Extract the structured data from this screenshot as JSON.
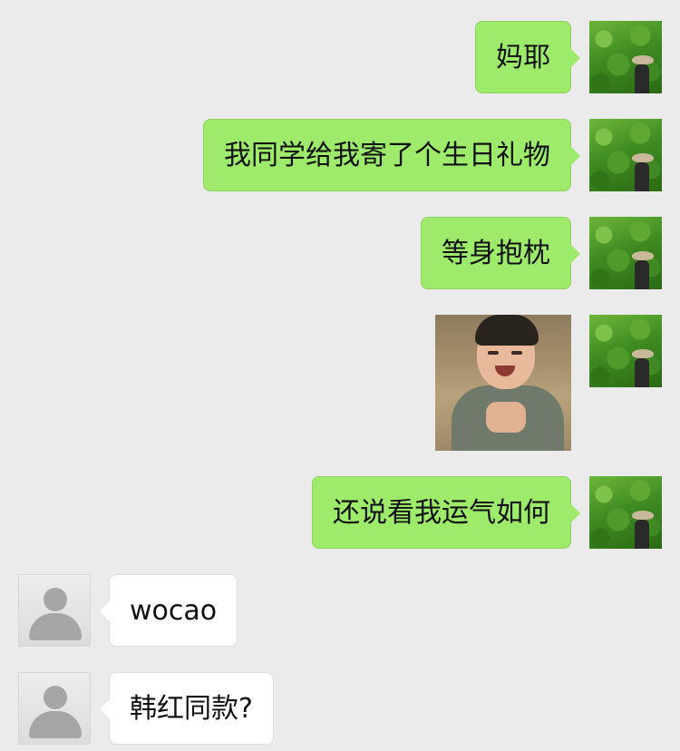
{
  "messages": [
    {
      "sender": "self",
      "type": "text",
      "text": "妈耶"
    },
    {
      "sender": "self",
      "type": "text",
      "text": "我同学给我寄了个生日礼物"
    },
    {
      "sender": "self",
      "type": "text",
      "text": "等身抱枕"
    },
    {
      "sender": "self",
      "type": "sticker",
      "sticker": "crying-child-sticker"
    },
    {
      "sender": "self",
      "type": "text",
      "text": "还说看我运气如何"
    },
    {
      "sender": "other",
      "type": "text",
      "text": "wocao"
    },
    {
      "sender": "other",
      "type": "text",
      "text": "韩红同款?"
    }
  ],
  "colors": {
    "background": "#ebebeb",
    "self_bubble": "#9eea6a",
    "other_bubble": "#ffffff"
  },
  "icons": {
    "self_avatar": "monk-in-forest-avatar",
    "other_avatar": "default-person-avatar"
  }
}
